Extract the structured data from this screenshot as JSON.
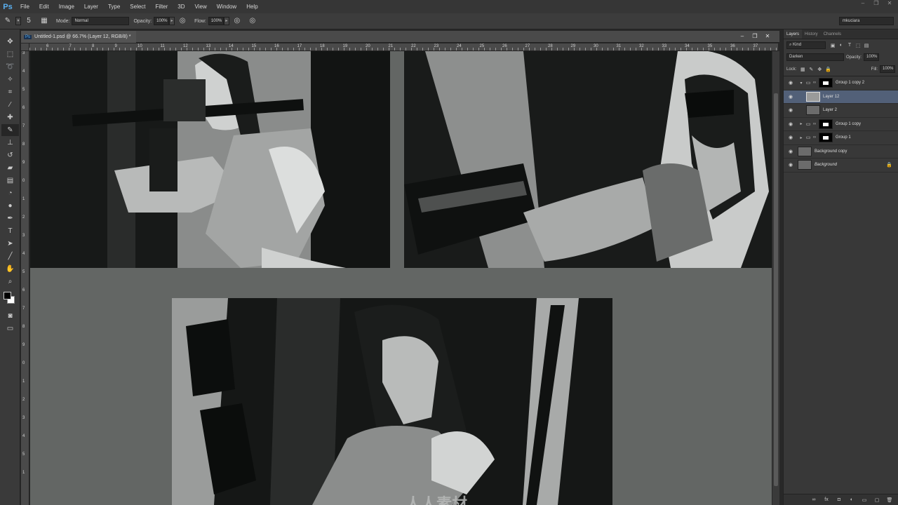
{
  "app": {
    "logo": "Ps"
  },
  "menu": [
    "File",
    "Edit",
    "Image",
    "Layer",
    "Type",
    "Select",
    "Filter",
    "3D",
    "View",
    "Window",
    "Help"
  ],
  "window_controls": [
    "–",
    "❐",
    "✕"
  ],
  "options": {
    "brush_size": "5",
    "mode_label": "Mode:",
    "mode_value": "Normal",
    "opacity_label": "Opacity:",
    "opacity_value": "100%",
    "flow_label": "Flow:",
    "flow_value": "100%",
    "workspace": "mkuciara"
  },
  "document": {
    "tab_icon": "Ps",
    "title": "Untitled-1.psd @ 66.7% (Layer 12, RGB/8) *",
    "controls": [
      "–",
      "❐",
      "✕"
    ],
    "ruler_h": [
      "6",
      "7",
      "8",
      "9",
      "10",
      "11",
      "12",
      "13",
      "14",
      "15",
      "16",
      "17",
      "18",
      "19",
      "20",
      "21",
      "22",
      "23",
      "24",
      "25",
      "26",
      "27",
      "28",
      "29",
      "30",
      "31",
      "32",
      "33",
      "34",
      "35",
      "36",
      "37"
    ],
    "ruler_v": [
      "3",
      "4",
      "5",
      "6",
      "7",
      "8",
      "9",
      "0",
      "1",
      "2",
      "3",
      "4",
      "5",
      "6",
      "7",
      "8",
      "9",
      "0",
      "1",
      "2",
      "3",
      "4",
      "5",
      "1"
    ],
    "watermark": "人人素材"
  },
  "panels": {
    "tabs": [
      "Layers",
      "History",
      "Channels"
    ],
    "filter_kind": "Kind",
    "blend_mode": "Darken",
    "opacity_label": "Opacity:",
    "opacity_value": "100%",
    "lock_label": "Lock:",
    "fill_label": "Fill:",
    "fill_value": "100%",
    "layers": [
      {
        "name": "Group 1 copy 2",
        "type": "group",
        "expanded": true,
        "visible": true,
        "selected": false
      },
      {
        "name": "Layer 12",
        "type": "layer",
        "visible": true,
        "selected": true
      },
      {
        "name": "Layer 2",
        "type": "layer",
        "visible": true,
        "selected": false
      },
      {
        "name": "Group 1 copy",
        "type": "group",
        "expanded": false,
        "visible": true,
        "selected": false
      },
      {
        "name": "Group 1",
        "type": "group",
        "expanded": false,
        "visible": true,
        "selected": false
      },
      {
        "name": "Background copy",
        "type": "layer",
        "visible": true,
        "selected": false
      },
      {
        "name": "Background",
        "type": "background",
        "visible": true,
        "selected": false
      }
    ]
  },
  "colors": {
    "accent": "#526078",
    "canvas": "#636664",
    "panel": "#383838",
    "ink": "#1d1f1e"
  }
}
